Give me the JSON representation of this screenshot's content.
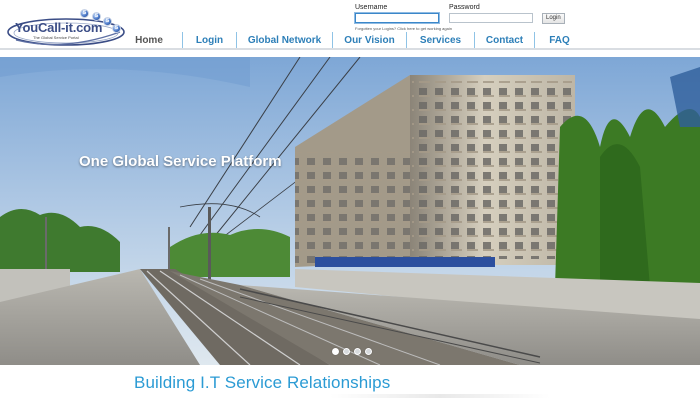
{
  "brand": {
    "name": "YouCall-it.com",
    "tagline": "The Global Service Portal",
    "bubble_letters": [
      "S",
      "S",
      "S",
      "S"
    ],
    "colors": {
      "logo_text": "#3b4d86",
      "nav": "#2d7fb8",
      "heading": "#2b9bd4"
    }
  },
  "login": {
    "username_label": "Username",
    "password_label": "Password",
    "username_value": "",
    "password_value": "",
    "login_button": "Login",
    "forgot_text": "Forgotten your Logins? Click here to get working again"
  },
  "nav": {
    "items": [
      {
        "label": "Home",
        "active": true
      },
      {
        "label": "Login"
      },
      {
        "label": "Global Network"
      },
      {
        "label": "Our Vision"
      },
      {
        "label": "Services"
      },
      {
        "label": "Contact"
      },
      {
        "label": "FAQ"
      }
    ]
  },
  "hero": {
    "headline": "One Global Service Platform",
    "slide_count": 4,
    "active_slide": 1
  },
  "content": {
    "heading": "Building I.T Service Relationships"
  }
}
